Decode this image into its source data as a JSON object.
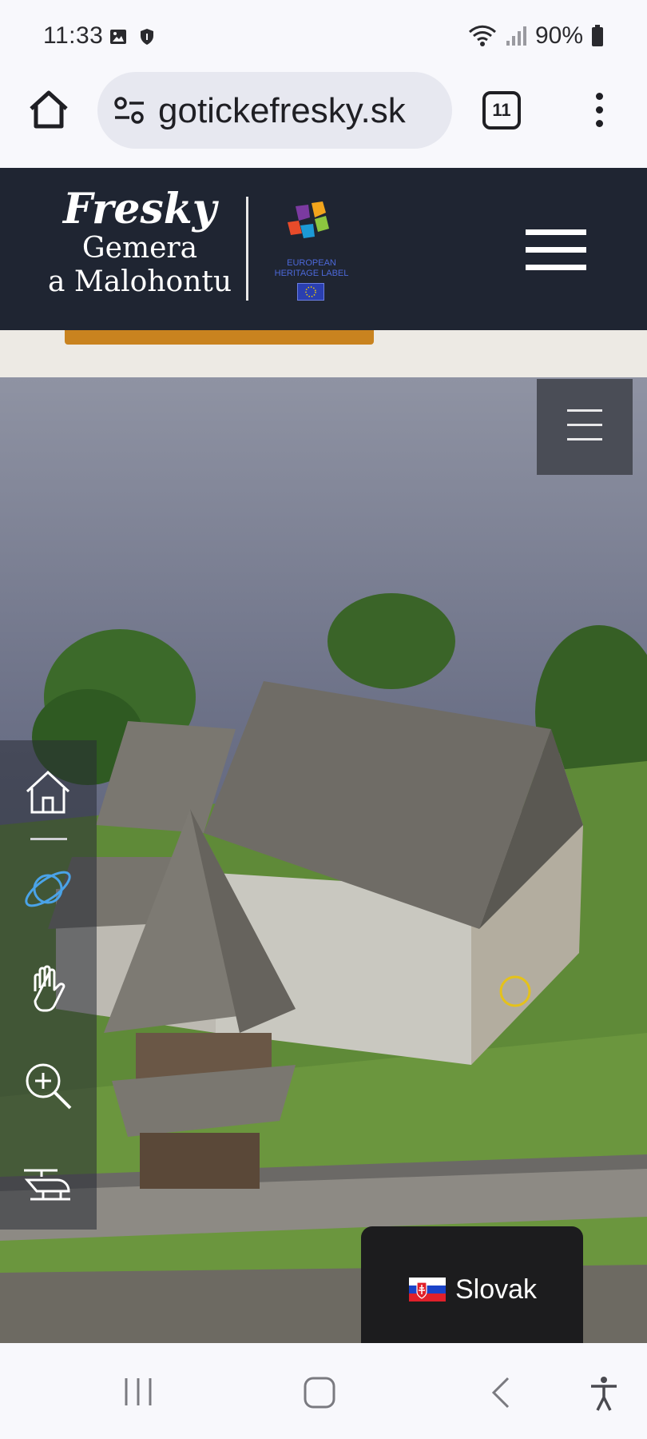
{
  "status_bar": {
    "time": "11:33",
    "battery": "90%",
    "icons": [
      "gallery-icon",
      "shield-icon",
      "wifi-icon",
      "signal-icon",
      "battery-icon"
    ]
  },
  "browser": {
    "url": "ɡotickefresky.sk",
    "tab_count": "11",
    "icons": [
      "home-icon",
      "site-settings-icon",
      "tabs-icon",
      "more-icon"
    ]
  },
  "site_header": {
    "logo_line1": "Fresky",
    "logo_line2": "Gemera",
    "logo_line3": "a Malohontu",
    "label_line1": "EUROPEAN",
    "label_line2": "HERITAGE LABEL",
    "menu_icon": "hamburger-icon"
  },
  "viewer": {
    "tools": [
      "home-icon",
      "orbit-icon",
      "pan-hand-icon",
      "zoom-in-icon",
      "helicopter-icon"
    ],
    "active_tool": "orbit-icon",
    "language_label": "Slovak",
    "language_flag": "slovakia-flag-icon"
  },
  "colors": {
    "header_bg": "#1f2532",
    "accent_orange": "#c9831f",
    "active_tool": "#4aa3e8"
  },
  "nav_bar": {
    "icons": [
      "recents-icon",
      "home-icon",
      "back-icon",
      "accessibility-icon"
    ]
  }
}
